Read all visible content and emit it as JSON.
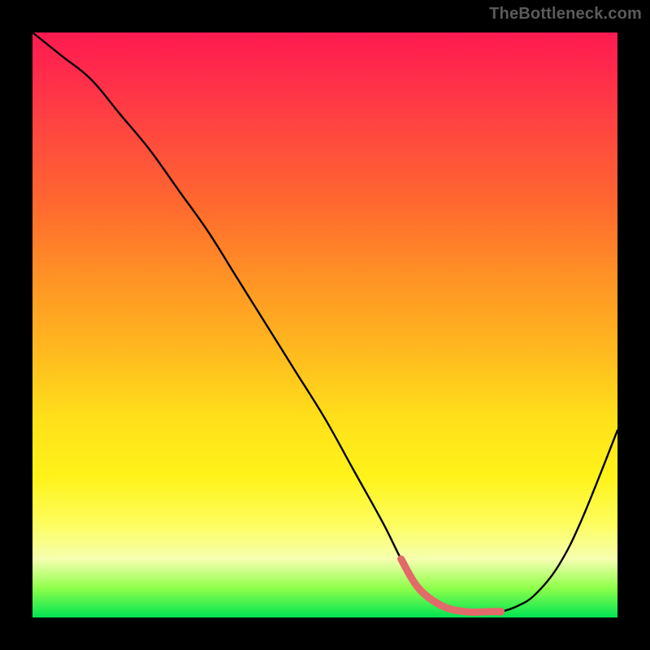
{
  "watermark": "TheBottleneck.com",
  "colors": {
    "background": "#000000",
    "watermark_text": "#5b5b5b",
    "curve": "#000000",
    "highlight": "#e26a6a",
    "gradient_top": "#ff1a51",
    "gradient_bottom": "#00e453"
  },
  "chart_data": {
    "type": "line",
    "title": "",
    "xlabel": "",
    "ylabel": "",
    "xlim": [
      0,
      100
    ],
    "ylim": [
      0,
      100
    ],
    "grid": false,
    "legend": false,
    "series": [
      {
        "name": "bottleneck-curve",
        "x": [
          0,
          5,
          10,
          15,
          20,
          25,
          30,
          35,
          40,
          45,
          50,
          55,
          60,
          63,
          66,
          70,
          74,
          78,
          80,
          83,
          86,
          90,
          94,
          100
        ],
        "values": [
          100,
          96,
          92,
          86,
          80,
          73,
          66,
          58,
          50,
          42,
          34,
          25,
          16,
          10,
          5,
          2,
          1,
          1,
          1,
          2,
          4,
          9,
          17,
          32
        ]
      }
    ],
    "highlight": {
      "name": "optimal-range",
      "x_start": 63,
      "x_end": 80
    },
    "annotations": []
  }
}
